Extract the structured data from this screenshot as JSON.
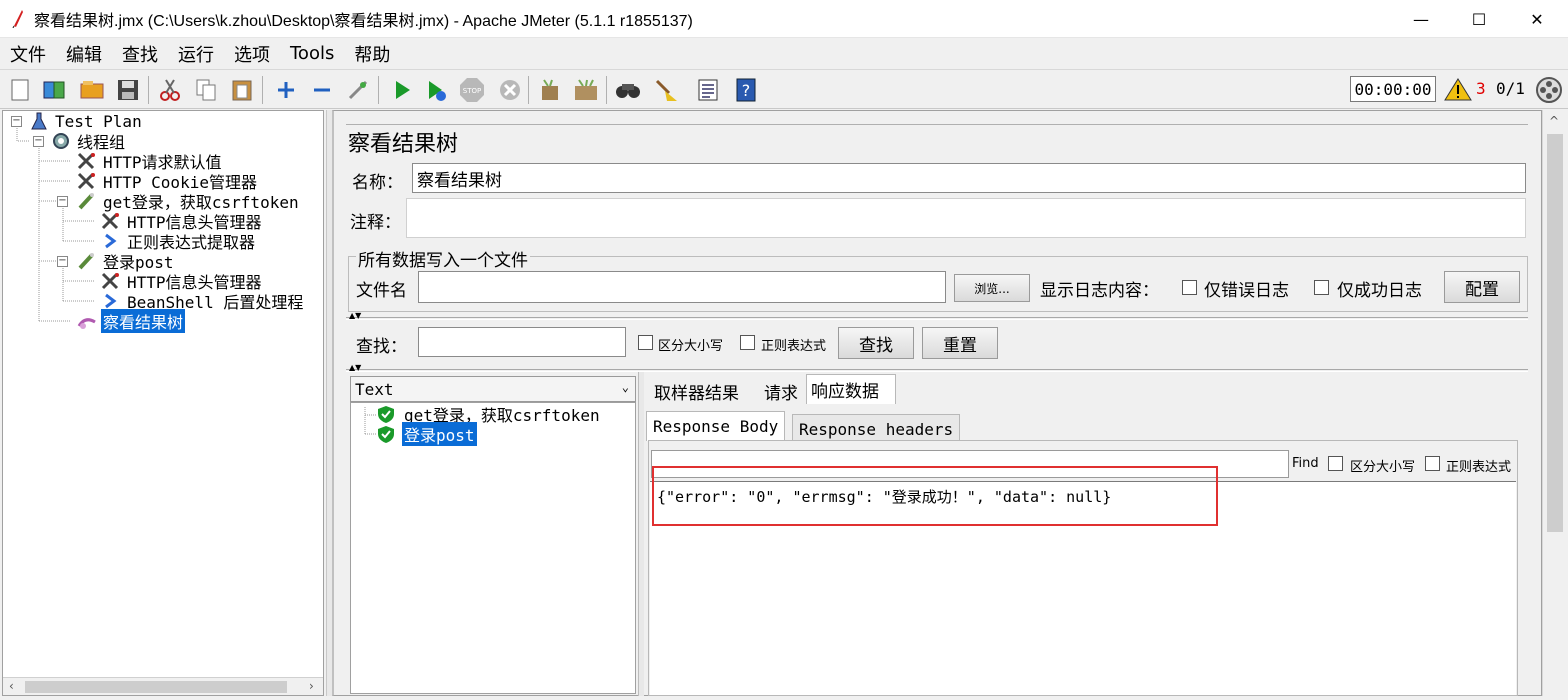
{
  "window": {
    "title": "察看结果树.jmx (C:\\Users\\k.zhou\\Desktop\\察看结果树.jmx) - Apache JMeter (5.1.1 r1855137)",
    "minimize": "—",
    "maximize": "☐",
    "close": "✕"
  },
  "menu": [
    "文件",
    "编辑",
    "查找",
    "运行",
    "选项",
    "Tools",
    "帮助"
  ],
  "toolbar": {
    "icons": [
      "new-icon",
      "templates-icon",
      "open-icon",
      "save-icon",
      "cut-icon",
      "copy-icon",
      "paste-icon",
      "expand-icon",
      "collapse-icon",
      "toggle-icon",
      "start-icon",
      "start-no-pause-icon",
      "stop-icon",
      "shutdown-icon",
      "clear-icon",
      "clear-all-icon",
      "search-icon",
      "reset-search-icon",
      "function-helper-icon",
      "help-icon"
    ],
    "timer": "00:00:00",
    "warning_count": "3",
    "thread_count": "0/1"
  },
  "tree": {
    "nodes": [
      {
        "label": "Test Plan",
        "icon": "test-plan-icon"
      },
      {
        "label": "线程组",
        "icon": "thread-group-icon"
      },
      {
        "label": "HTTP请求默认值",
        "icon": "config-element-icon"
      },
      {
        "label": "HTTP Cookie管理器",
        "icon": "config-element-icon"
      },
      {
        "label": "get登录，获取csrftoken",
        "icon": "sampler-icon"
      },
      {
        "label": "HTTP信息头管理器",
        "icon": "config-element-icon"
      },
      {
        "label": "正则表达式提取器",
        "icon": "post-processor-icon"
      },
      {
        "label": "登录post",
        "icon": "sampler-icon"
      },
      {
        "label": "HTTP信息头管理器",
        "icon": "config-element-icon"
      },
      {
        "label": "BeanShell 后置处理程",
        "icon": "post-processor-icon"
      },
      {
        "label": "察看结果树",
        "icon": "listener-icon"
      }
    ]
  },
  "panel": {
    "title": "察看结果树",
    "name_label": "名称：",
    "name_value": "察看结果树",
    "comment_label": "注释：",
    "file_group_legend": "所有数据写入一个文件",
    "filename_label": "文件名",
    "browse_button": "浏览...",
    "log_content_label": "显示日志内容：",
    "errors_only": "仅错误日志",
    "success_only": "仅成功日志",
    "configure_button": "配置",
    "search_label": "查找：",
    "case_sensitive": "区分大小写",
    "regex": "正则表达式",
    "search_button": "查找",
    "reset_button": "重置"
  },
  "results": {
    "renderer": "Text",
    "items": [
      {
        "label": "get登录，获取csrftoken",
        "icon": "success-shield-icon"
      },
      {
        "label": "登录post",
        "icon": "success-shield-icon"
      }
    ]
  },
  "tabs": [
    "取样器结果",
    "请求",
    "响应数据"
  ],
  "subtabs": [
    "Response Body",
    "Response headers"
  ],
  "response": {
    "find_label": "Find",
    "case_sensitive": "区分大小写",
    "regex": "正则表达式",
    "body": "{\"error\": \"0\", \"errmsg\": \"登录成功！\", \"data\": null}"
  }
}
